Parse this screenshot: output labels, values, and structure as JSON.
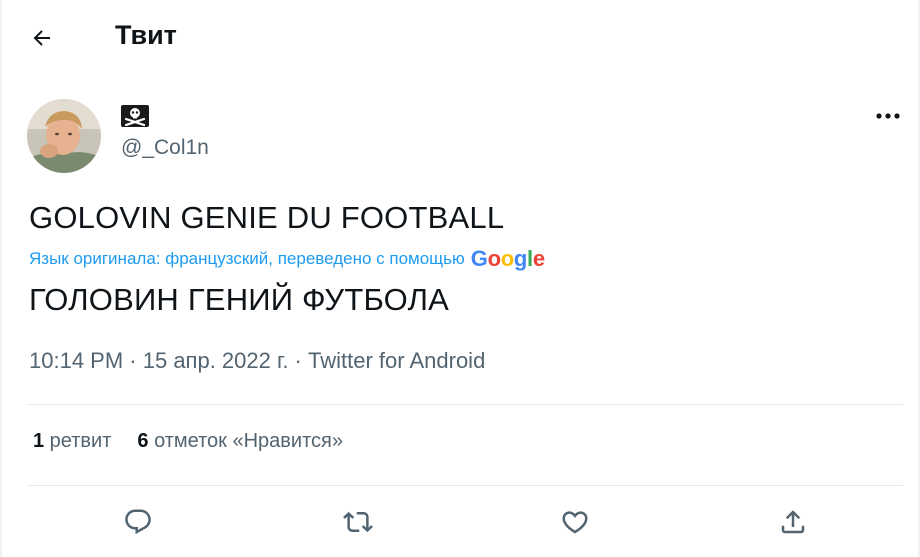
{
  "header": {
    "title": "Твит",
    "back_icon": "arrow-left-icon"
  },
  "author": {
    "display_name_icon": "skull-crossbones-icon",
    "username": "@_Col1n"
  },
  "tweet": {
    "text": "GOLOVIN GENIE DU FOOTBALL",
    "translation_note": "Язык оригинала: французский, переведено с помощью",
    "translation_provider": "Google",
    "translated_text": "ГОЛОВИН ГЕНИЙ ФУТБОЛА"
  },
  "meta": {
    "time": "10:14 PM",
    "separator": " · ",
    "date": "15 апр. 2022 г.",
    "source": "Twitter for Android"
  },
  "stats": {
    "retweets_count": "1",
    "retweets_label": " ретвит",
    "likes_count": "6",
    "likes_label": " отметок «Нравится»"
  },
  "actions": [
    "reply-icon",
    "retweet-icon",
    "like-icon",
    "share-icon"
  ],
  "colors": {
    "text": "#0f1419",
    "secondary": "#536471",
    "accent": "#1d9bf0",
    "google_blue": "#4285F4",
    "google_red": "#EA4335",
    "google_yellow": "#FBBC05",
    "google_green": "#34A853"
  }
}
